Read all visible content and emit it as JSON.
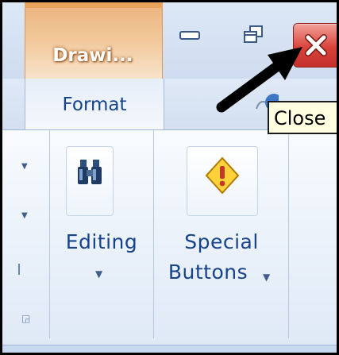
{
  "title_bar": {
    "contextual_tab_title": "Drawi...",
    "minimize_icon": "minimize-icon",
    "restore_icon": "restore-icon",
    "close_icon": "close-icon"
  },
  "ribbon_tabs": {
    "format_label": "Format"
  },
  "groups": {
    "editing": {
      "label": "Editing",
      "icon": "binoculars-icon"
    },
    "special_buttons": {
      "label_line1": "Special",
      "label_line2": "Buttons",
      "icon": "warning-diamond-icon"
    }
  },
  "tooltip": {
    "text": "Close"
  },
  "colors": {
    "accent_text": "#15428b",
    "contextual_tab": "#f1c697",
    "close_button": "#d9433c",
    "tooltip_bg": "#ffffe1"
  }
}
